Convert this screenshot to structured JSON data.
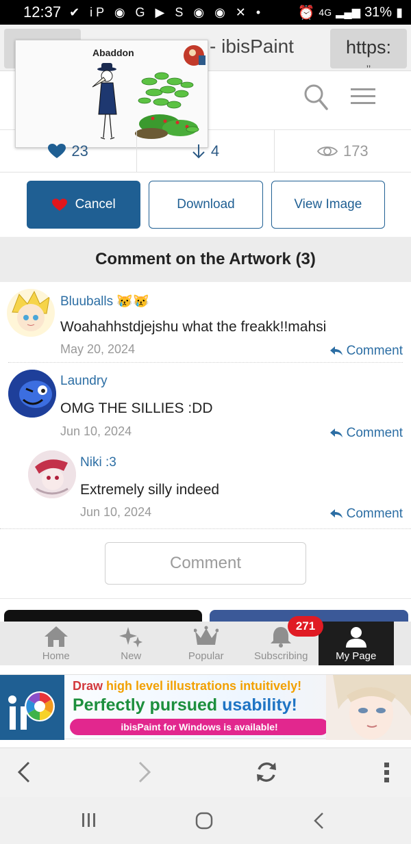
{
  "status_bar": {
    "time": "12:37",
    "icons": "✔ iP ◉ G ▶ S ◉ ◉ ✕ •",
    "network": "4G",
    "battery": "31%"
  },
  "browser": {
    "page_title": "- ibisPaint",
    "url_label": "https:",
    "url_more": "‚‚"
  },
  "artwork": {
    "title": "Abaddon"
  },
  "stats": {
    "likes": "23",
    "downloads": "4",
    "views": "173"
  },
  "buttons": {
    "cancel": "Cancel",
    "download": "Download",
    "view_image": "View Image"
  },
  "comments_section": {
    "title": "Comment on the Artwork",
    "count": "(3)",
    "reply_label": "Comment",
    "items": [
      {
        "author": "Bluuballs",
        "emoji": "😿😿",
        "text": "Woahahhstdjejshu what the freakk!!mahsi",
        "date": "May 20, 2024"
      },
      {
        "author": "Laundry",
        "text": "OMG THE SILLIES :DD",
        "date": "Jun 10, 2024"
      },
      {
        "author": "Niki :3",
        "text": "Extremely silly indeed",
        "date": "Jun 10, 2024"
      }
    ],
    "comment_button": "Comment"
  },
  "bottom_nav": {
    "items": [
      {
        "label": "Home",
        "icon": "home-icon"
      },
      {
        "label": "New",
        "icon": "sparkle-icon"
      },
      {
        "label": "Popular",
        "icon": "crown-icon"
      },
      {
        "label": "Subscribing",
        "icon": "bell-icon"
      },
      {
        "label": "My Page",
        "icon": "person-icon"
      }
    ],
    "badge": "271",
    "active": "My Page"
  },
  "ad": {
    "line1_a": "Draw ",
    "line1_b": "high level illustrations intuitively!",
    "line2_a": "Perfectly pursued ",
    "line2_b": "usability!",
    "pill": "ibisPaint for Windows is available!"
  },
  "colors": {
    "accent": "#1f5f93",
    "link": "#2c6ea4",
    "badge": "#e01b24",
    "active_nav": "#1d1d1d"
  }
}
